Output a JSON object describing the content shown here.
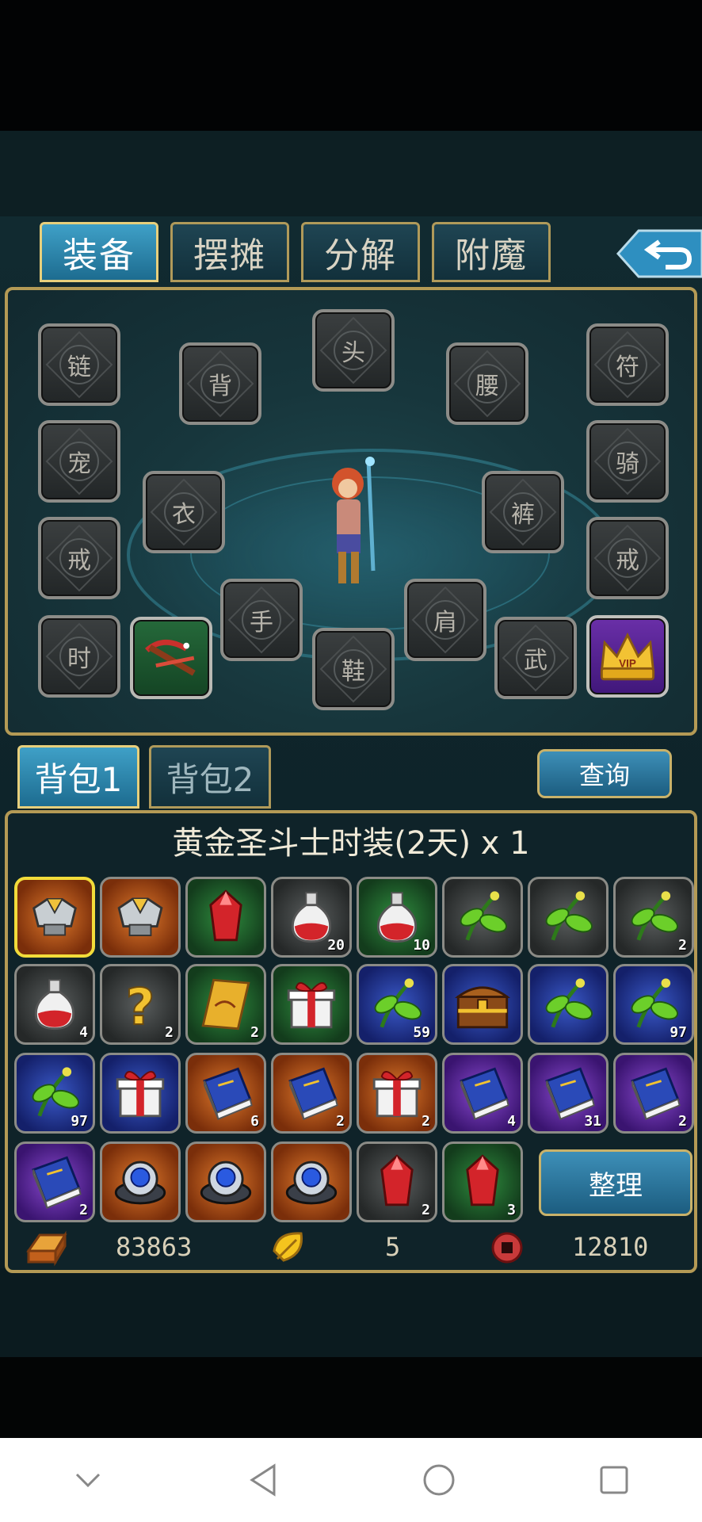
{
  "tabs": [
    "装备",
    "摆摊",
    "分解",
    "附魔"
  ],
  "equip_slots": [
    "链",
    "背",
    "头",
    "腰",
    "符",
    "宠",
    "衣",
    "裤",
    "骑",
    "戒",
    "戒",
    "手",
    "肩",
    "时",
    "鞋",
    "武"
  ],
  "bag_tabs": [
    "背包1",
    "背包2"
  ],
  "query_label": "查询",
  "item_title": "黄金圣斗士时装(2天) x 1",
  "bag_items": [
    {
      "icon": "armor-icon",
      "bg": "orange",
      "count": ""
    },
    {
      "icon": "armor-icon",
      "bg": "orange",
      "count": ""
    },
    {
      "icon": "red-gem-icon",
      "bg": "green",
      "count": ""
    },
    {
      "icon": "red-potion-icon",
      "bg": "gray",
      "count": "20"
    },
    {
      "icon": "red-potion-icon",
      "bg": "green",
      "count": "10"
    },
    {
      "icon": "herb-icon",
      "bg": "gray",
      "count": ""
    },
    {
      "icon": "herb-icon",
      "bg": "gray",
      "count": ""
    },
    {
      "icon": "herb-icon",
      "bg": "gray",
      "count": "2"
    },
    {
      "icon": "red-potion-icon",
      "bg": "gray",
      "count": "4"
    },
    {
      "icon": "question-mark-icon",
      "bg": "gray",
      "count": "2"
    },
    {
      "icon": "golden-card-icon",
      "bg": "green",
      "count": "2"
    },
    {
      "icon": "gift-box-icon",
      "bg": "green",
      "count": ""
    },
    {
      "icon": "herb-icon",
      "bg": "blue",
      "count": "59"
    },
    {
      "icon": "treasure-chest-icon",
      "bg": "blue",
      "count": ""
    },
    {
      "icon": "herb-icon",
      "bg": "blue",
      "count": ""
    },
    {
      "icon": "herb-icon",
      "bg": "blue",
      "count": "97"
    },
    {
      "icon": "herb-icon",
      "bg": "blue",
      "count": "97"
    },
    {
      "icon": "gift-box-icon",
      "bg": "blue",
      "count": ""
    },
    {
      "icon": "blue-book-icon",
      "bg": "orange",
      "count": "6"
    },
    {
      "icon": "blue-book-icon",
      "bg": "orange",
      "count": "2"
    },
    {
      "icon": "gift-box-icon",
      "bg": "orange",
      "count": "2"
    },
    {
      "icon": "blue-book-icon",
      "bg": "purple",
      "count": "4"
    },
    {
      "icon": "blue-book-icon",
      "bg": "purple",
      "count": "31"
    },
    {
      "icon": "blue-book-icon",
      "bg": "purple",
      "count": "2"
    },
    {
      "icon": "blue-book-icon",
      "bg": "purple",
      "count": "2"
    },
    {
      "icon": "blue-orb-icon",
      "bg": "orange",
      "count": ""
    },
    {
      "icon": "blue-orb-icon",
      "bg": "orange",
      "count": ""
    },
    {
      "icon": "blue-orb-icon",
      "bg": "orange",
      "count": ""
    },
    {
      "icon": "red-gem-icon",
      "bg": "gray",
      "count": "2"
    },
    {
      "icon": "red-gem-icon",
      "bg": "green",
      "count": "3"
    }
  ],
  "sort_label": "整理",
  "currency": {
    "gold": "83863",
    "leaf": "5",
    "coin": "12810"
  }
}
